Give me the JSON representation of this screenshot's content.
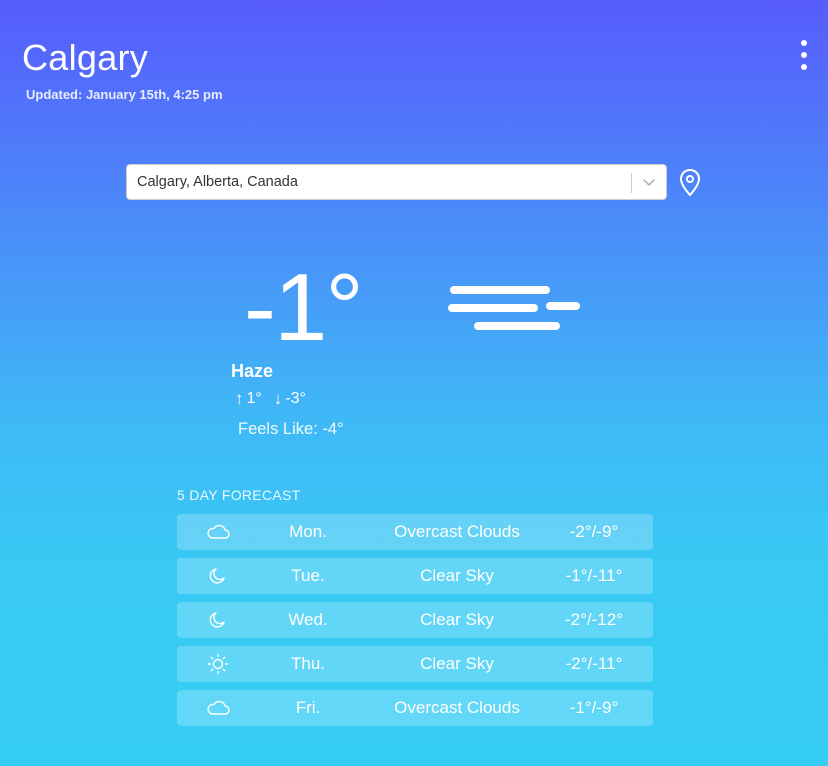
{
  "header": {
    "city": "Calgary",
    "updated": "Updated: January 15th, 4:25 pm",
    "menu_icon": "more-vertical-icon"
  },
  "search": {
    "value": "Calgary, Alberta, Canada",
    "dropdown_icon": "chevron-down-icon",
    "location_icon": "map-pin-icon"
  },
  "current": {
    "temperature": "-1°",
    "condition": "Haze",
    "high": "1°",
    "low": "-3°",
    "feels_like": "Feels Like: -4°",
    "icon": "haze-icon"
  },
  "forecast": {
    "title": "5 DAY FORECAST",
    "days": [
      {
        "day": "Mon.",
        "description": "Overcast Clouds",
        "temps": "-2°/-9°",
        "icon": "cloud-icon"
      },
      {
        "day": "Tue.",
        "description": "Clear Sky",
        "temps": "-1°/-11°",
        "icon": "moon-icon"
      },
      {
        "day": "Wed.",
        "description": "Clear Sky",
        "temps": "-2°/-12°",
        "icon": "moon-icon"
      },
      {
        "day": "Thu.",
        "description": "Clear Sky",
        "temps": "-2°/-11°",
        "icon": "sun-icon"
      },
      {
        "day": "Fri.",
        "description": "Overcast Clouds",
        "temps": "-1°/-9°",
        "icon": "cloud-icon"
      }
    ]
  }
}
